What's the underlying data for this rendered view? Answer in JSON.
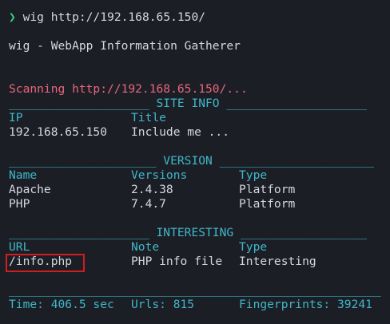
{
  "prompt": {
    "symbol": "❯",
    "command": "wig http://192.168.65.150/"
  },
  "banner": "wig - WebApp Information Gatherer",
  "scanning": "Scanning http://192.168.65.150/...",
  "sections": {
    "site_info": {
      "rule": "____________________ SITE INFO ____________________"
    },
    "version": {
      "rule": "_____________________ VERSION ______________________"
    },
    "interesting": {
      "rule": "____________________ INTERESTING __________________"
    },
    "footer_rule": "_____________________________________________________"
  },
  "site_info": {
    "headers": [
      "IP",
      "Title"
    ],
    "row": [
      "192.168.65.150",
      "Include me ..."
    ]
  },
  "version": {
    "headers": [
      "Name",
      "Versions",
      "Type"
    ],
    "rows": [
      [
        "Apache",
        "2.4.38",
        "Platform"
      ],
      [
        "PHP",
        "7.4.7",
        "Platform"
      ]
    ]
  },
  "interesting": {
    "headers": [
      "URL",
      "Note",
      "Type"
    ],
    "rows": [
      [
        "/info.php",
        "PHP info file",
        "Interesting"
      ]
    ]
  },
  "footer": {
    "time": "Time: 406.5 sec",
    "urls": "Urls: 815",
    "fingerprints": "Fingerprints: 39241"
  },
  "colors": {
    "background": "#1c1e26",
    "text": "#d3d7de",
    "scan_red": "#e8677a",
    "header_cyan": "#3fb7c8",
    "prompt_green": "#35d07f",
    "highlight_box": "#d11d1d"
  }
}
